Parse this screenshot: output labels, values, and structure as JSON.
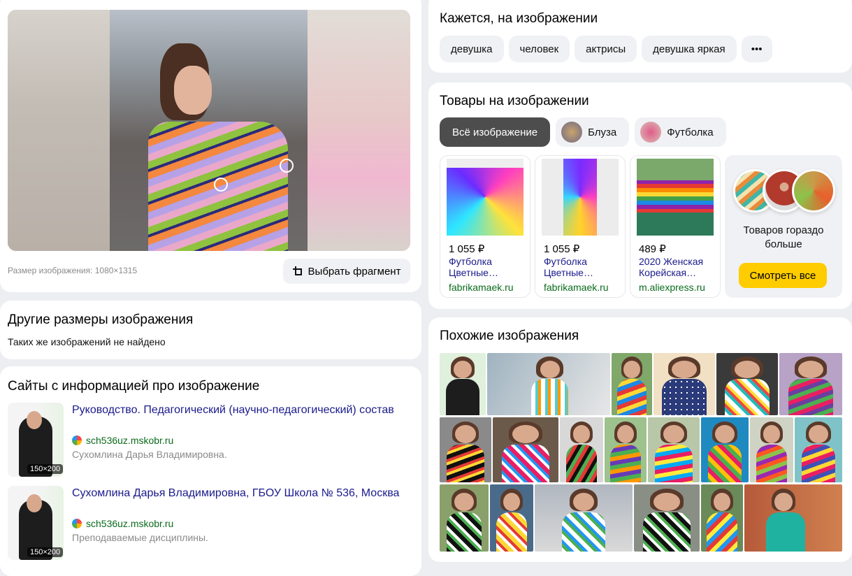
{
  "preview": {
    "size_text": "Размер изображения: 1080×1315",
    "crop_button": "Выбрать фрагмент"
  },
  "other_sizes": {
    "title": "Другие размеры изображения",
    "message": "Таких же изображений не найдено"
  },
  "sites": {
    "title": "Сайты с информацией про изображение",
    "items": [
      {
        "title": "Руководство. Педагогический (научно-педагогический) состав",
        "domain": "sch536uz.mskobr.ru",
        "description": "Сухомлина Дарья Владимировна.",
        "thumb_badge": "150×200"
      },
      {
        "title": "Сухомлина Дарья Владимировна, ГБОУ Школа № 536, Москва",
        "domain": "sch536uz.mskobr.ru",
        "description": "Преподаваемые дисциплины.",
        "thumb_badge": "150×200"
      }
    ]
  },
  "tags": {
    "title": "Кажется, на изображении",
    "items": [
      "девушка",
      "человек",
      "актрисы",
      "девушка яркая"
    ],
    "more_label": "•••"
  },
  "products": {
    "title": "Товары на изображении",
    "filters": [
      {
        "label": "Всё изображение",
        "active": true
      },
      {
        "label": "Блуза",
        "active": false
      },
      {
        "label": "Футболка",
        "active": false
      }
    ],
    "items": [
      {
        "price": "1 055 ₽",
        "title": "Футболка Цветные…",
        "shop": "fabrikamaek.ru"
      },
      {
        "price": "1 055 ₽",
        "title": "Футболка Цветные…",
        "shop": "fabrikamaek.ru"
      },
      {
        "price": "489 ₽",
        "title": "2020 Женская Корейская…",
        "shop": "m.aliexpress.ru"
      }
    ],
    "more_text": "Товаров гораздо больше",
    "view_all": "Смотреть все"
  },
  "similar": {
    "title": "Похожие изображения"
  },
  "colors": {
    "accent_yellow": "#ffcc00",
    "link": "#1a1a8c",
    "domain_green": "#0a6b1b"
  }
}
